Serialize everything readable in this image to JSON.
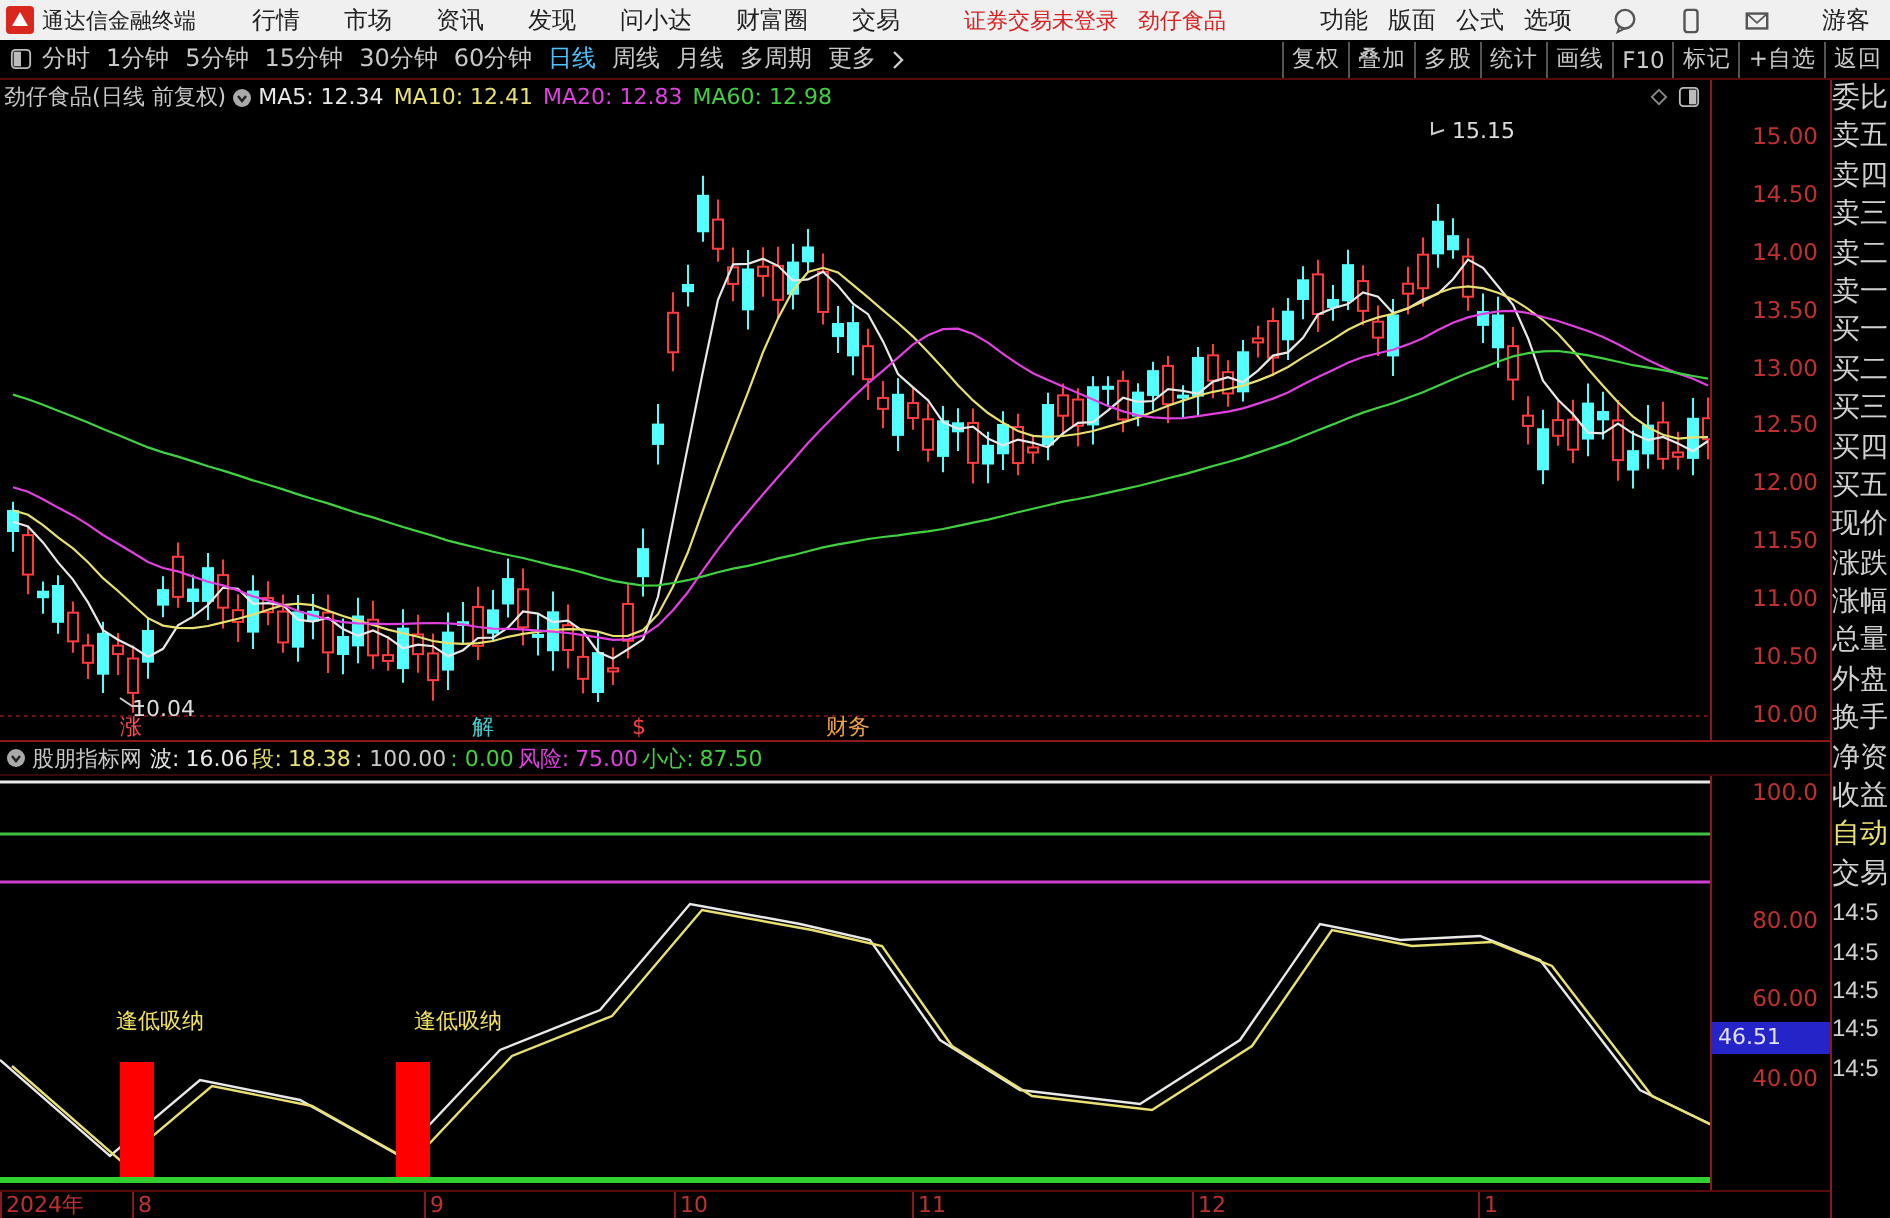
{
  "app": {
    "title": "通达信金融终端",
    "menu": [
      "行情",
      "市场",
      "资讯",
      "发现",
      "问小达",
      "财富圈",
      "交易"
    ],
    "notice": "证券交易未登录",
    "stock": "劲仔食品",
    "tools": [
      "功能",
      "版面",
      "公式",
      "选项"
    ],
    "user": "游客"
  },
  "periods": [
    {
      "label": "分时",
      "selected": false
    },
    {
      "label": "1分钟",
      "selected": false
    },
    {
      "label": "5分钟",
      "selected": false
    },
    {
      "label": "15分钟",
      "selected": false
    },
    {
      "label": "30分钟",
      "selected": false
    },
    {
      "label": "60分钟",
      "selected": false
    },
    {
      "label": "日线",
      "selected": true
    },
    {
      "label": "周线",
      "selected": false
    },
    {
      "label": "月线",
      "selected": false
    },
    {
      "label": "多周期",
      "selected": false
    },
    {
      "label": "更多",
      "selected": false
    }
  ],
  "actions": [
    "复权",
    "叠加",
    "多股",
    "统计",
    "画线",
    "F10",
    "标记",
    "+自选",
    "返回"
  ],
  "chart": {
    "title": "劲仔食品(日线 前复权)",
    "ma": [
      {
        "label": "MA5: 12.34",
        "color": "#e8e8e8"
      },
      {
        "label": "MA10: 12.41",
        "color": "#e8e070"
      },
      {
        "label": "MA20: 12.83",
        "color": "#e040e0"
      },
      {
        "label": "MA60: 12.98",
        "color": "#40d040"
      }
    ],
    "high_label": "15.15",
    "low_label": "10.04",
    "events": [
      {
        "text": "涨",
        "color": "#ff5050"
      },
      {
        "text": "解",
        "color": "#40d0d0"
      },
      {
        "text": "$",
        "color": "#ff4040"
      },
      {
        "text": "财务",
        "color": "#f0a040"
      }
    ],
    "y_ticks": [
      "15.00",
      "14.50",
      "14.00",
      "13.50",
      "13.00",
      "12.50",
      "12.00",
      "11.50",
      "11.00",
      "10.50",
      "10.00"
    ]
  },
  "indicator": {
    "name": "股朋指标网",
    "values": [
      {
        "label": "波:",
        "value": "16.06",
        "color": "#e8e8e8"
      },
      {
        "label": "段:",
        "value": "18.38",
        "color": "#e8e070"
      },
      {
        "value": ": 100.00",
        "color": "#c8c8c8"
      },
      {
        "value": ": 0.00",
        "color": "#40d040"
      },
      {
        "label": "风险:",
        "value": "75.00",
        "color": "#e040e0"
      },
      {
        "label": "小心:",
        "value": "87.50",
        "color": "#40d040"
      }
    ],
    "signals": [
      "逢低吸纳",
      "逢低吸纳"
    ],
    "y_ticks": [
      "100.0",
      "80.00",
      "60.00",
      "40.00"
    ],
    "current": "46.51"
  },
  "x_axis": [
    "2024年",
    "8",
    "9",
    "10",
    "11",
    "12",
    "1"
  ],
  "side_panel": {
    "labels": [
      "委比",
      "卖五",
      "卖四",
      "卖三",
      "卖二",
      "卖一",
      "买一",
      "买二",
      "买三",
      "买四",
      "买五",
      "现价",
      "涨跌",
      "涨幅",
      "总量",
      "外盘",
      "换手",
      "净资",
      "收益"
    ],
    "mode": [
      "自动",
      "交易"
    ],
    "times": [
      "14:5",
      "14:5",
      "14:5",
      "14:5",
      "14:5"
    ]
  }
}
